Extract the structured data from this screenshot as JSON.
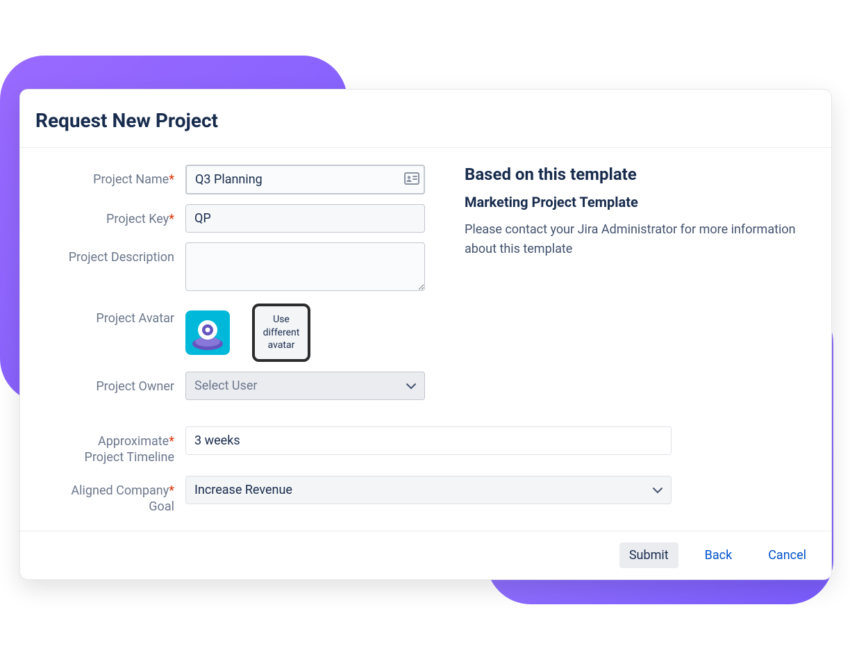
{
  "dialog": {
    "title": "Request New Project"
  },
  "form": {
    "project_name": {
      "label": "Project Name",
      "value": "Q3 Planning"
    },
    "project_key": {
      "label": "Project Key",
      "value": "QP"
    },
    "project_description": {
      "label": "Project Description",
      "value": ""
    },
    "project_avatar": {
      "label": "Project Avatar",
      "button": "Use different avatar"
    },
    "project_owner": {
      "label": "Project Owner",
      "placeholder": "Select User"
    },
    "timeline": {
      "label": "Approximate Project Timeline",
      "value": "3 weeks"
    },
    "company_goal": {
      "label": "Aligned Company Goal",
      "value": "Increase Revenue"
    }
  },
  "template": {
    "heading": "Based on this template",
    "name": "Marketing Project Template",
    "description": "Please contact your Jira Administrator for more information about this template"
  },
  "footer": {
    "submit": "Submit",
    "back": "Back",
    "cancel": "Cancel"
  }
}
